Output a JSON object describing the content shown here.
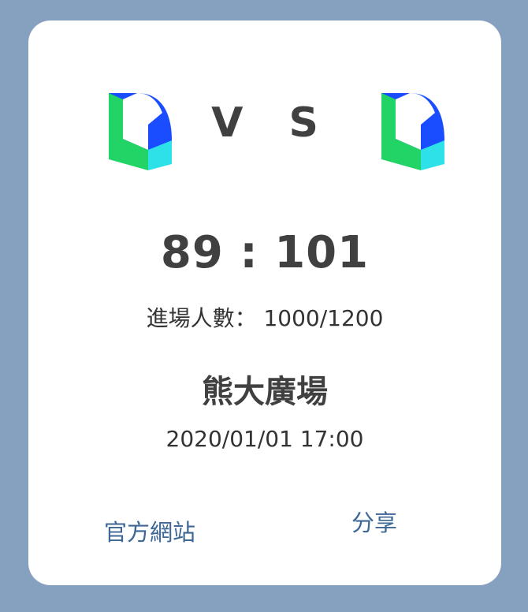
{
  "match": {
    "vs_label": "V S",
    "score": "89 : 101",
    "attendance_label": "進場人數：",
    "attendance_value": "1000/1200",
    "venue": "熊大廣場",
    "datetime": "2020/01/01 17:00"
  },
  "teams": {
    "home": {
      "logo_icon": "team-logo-icon"
    },
    "away": {
      "logo_icon": "team-logo-icon"
    }
  },
  "actions": {
    "official_site_label": "官方網站",
    "share_label": "分享"
  },
  "colors": {
    "background": "#86a0c0",
    "card": "#ffffff",
    "text_dark": "#404040",
    "link": "#3d6796",
    "logo_blue": "#1a4dff",
    "logo_green": "#22d466",
    "logo_cyan": "#2ee0e8"
  }
}
